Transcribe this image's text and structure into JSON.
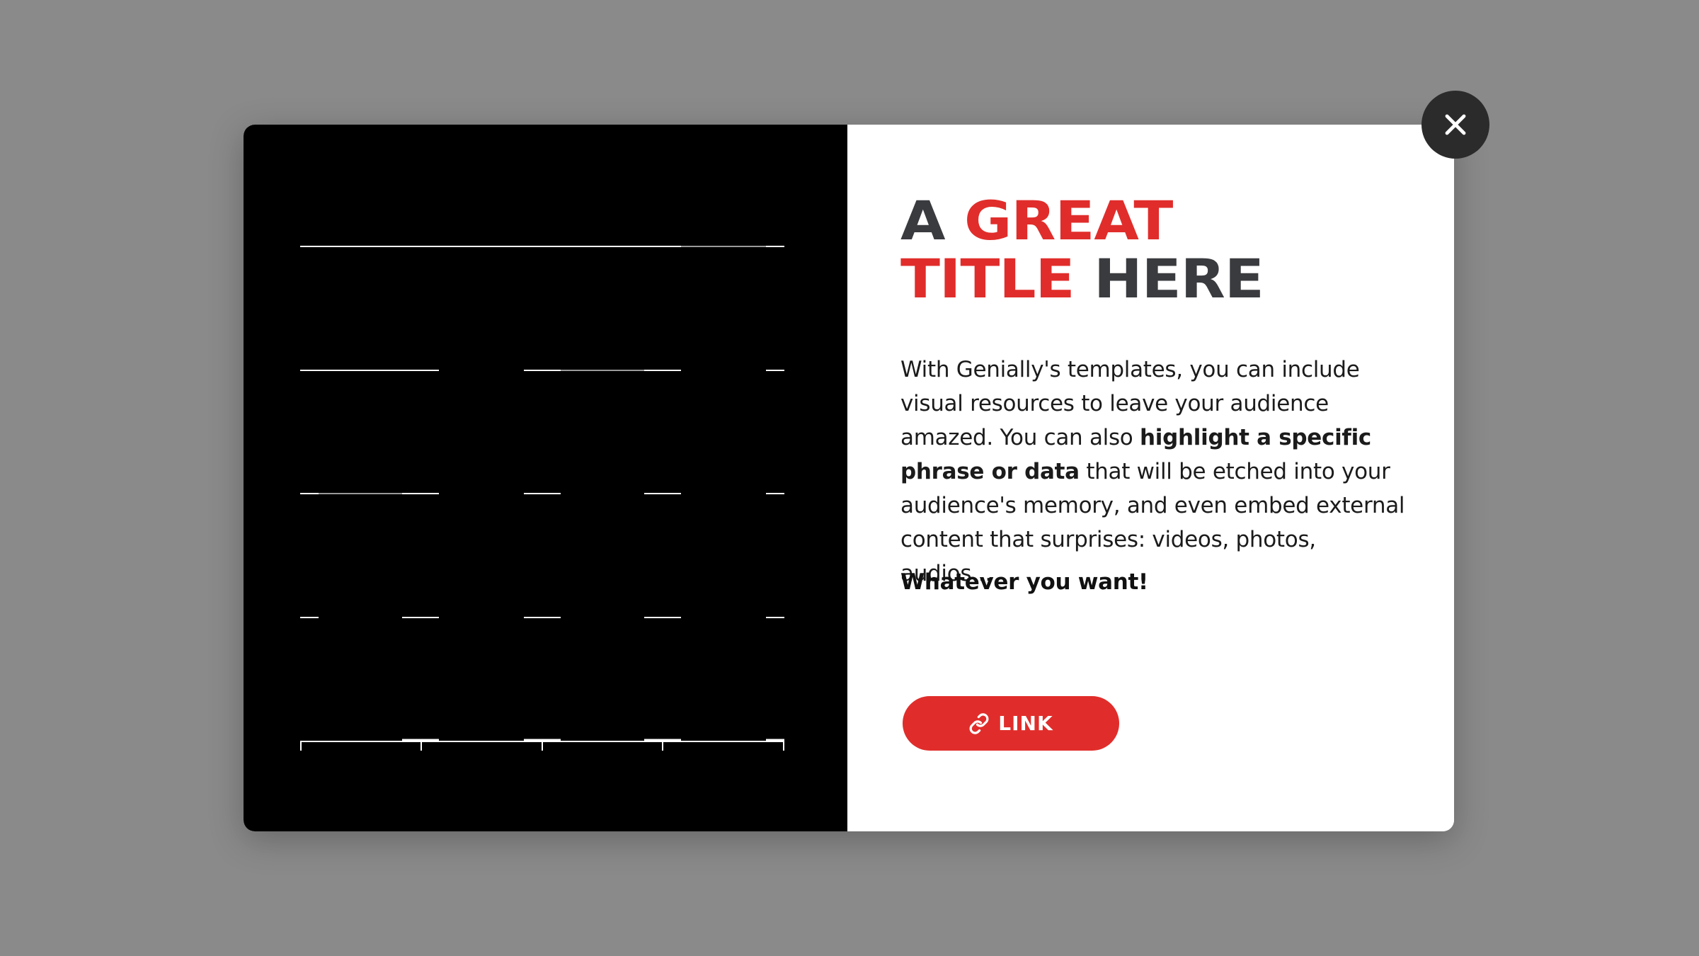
{
  "title": {
    "word1": "A",
    "word2": "GREAT",
    "word3": "TITLE",
    "word4": "HERE"
  },
  "body": {
    "part1": "With Genially's templates, you can include visual resources to leave your audience amazed. You can also ",
    "highlight": "highlight a specific phrase or data",
    "part2": " that will be etched into your audience's memory, and even embed external content that surprises: videos, photos, audios..."
  },
  "closing": "Whatever you want!",
  "link_button": {
    "label": "LINK",
    "icon": "link-icon"
  },
  "close_button": {
    "icon": "close-icon"
  },
  "colors": {
    "accent": "#e02d2b",
    "title_dark": "#3a3b3f",
    "overlay": "#8a8a8a",
    "close_bg": "#2b2b2b"
  }
}
